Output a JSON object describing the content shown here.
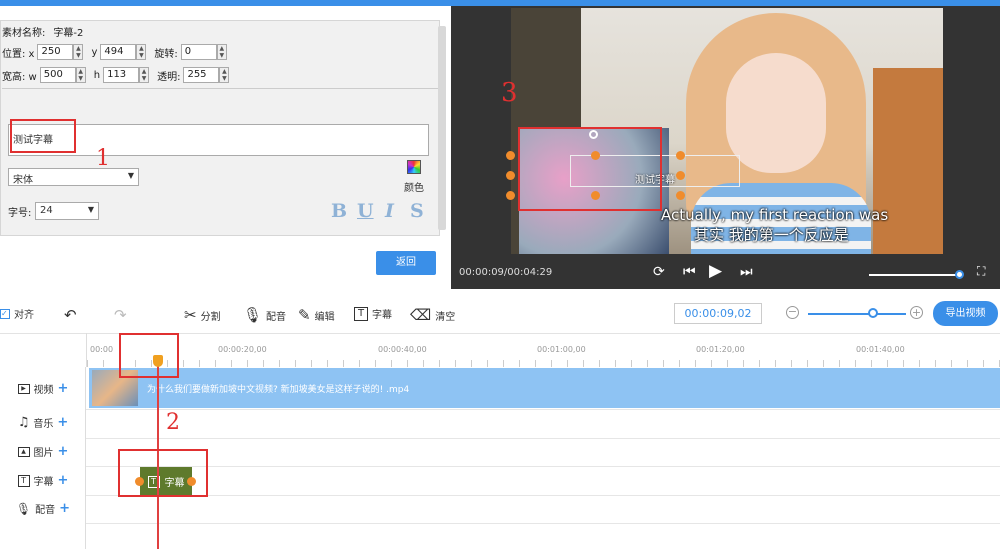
{
  "props": {
    "name_label": "素材名称:",
    "name_value": "字幕-2",
    "pos_label": "位置: x",
    "x": "250",
    "y_label": "y",
    "y": "494",
    "rotate_label": "旋转:",
    "rotate": "0",
    "size_label": "宽高: w",
    "w": "500",
    "h_label": "h",
    "h": "113",
    "opacity_label": "透明:",
    "opacity": "255",
    "text_value": "测试字幕",
    "font": "宋体",
    "color_label": "颜色",
    "fontsize_label": "字号:",
    "fontsize": "24",
    "bold": "B",
    "underline": "U",
    "italic": "I",
    "strike": "S",
    "return_button": "返回"
  },
  "preview": {
    "overlay_text": "测试字幕",
    "caption_en": "Actually, my first reaction was",
    "caption_zh": "其实 我的第一个反应是",
    "time": "00:00:09/00:04:29"
  },
  "toolbar": {
    "align_label": "对齐",
    "split": "分割",
    "dub": "配音",
    "edit": "编辑",
    "subtitle": "字幕",
    "clear": "清空",
    "timecode": "00:00:09,02",
    "export": "导出视频"
  },
  "timeline": {
    "ticks": [
      "00:00",
      "00:00:20,00",
      "00:00:40,00",
      "00:01:00,00",
      "00:01:20,00",
      "00:01:40,00"
    ],
    "tracks": [
      "视频",
      "音乐",
      "图片",
      "字幕",
      "配音"
    ],
    "video_clip_title": "为什么我们要做新加坡中文视频? 新加坡美女是这样子说的! .mp4",
    "subtitle_clip_label": "字幕"
  },
  "annotations": {
    "mark1": "1",
    "mark2": "2",
    "mark3": "3"
  },
  "colors": {
    "accent": "#3a8fe8",
    "annotation_red": "#e03030",
    "subtitle_clip": "#5e7a2c",
    "handle_orange": "#f08c2c"
  }
}
